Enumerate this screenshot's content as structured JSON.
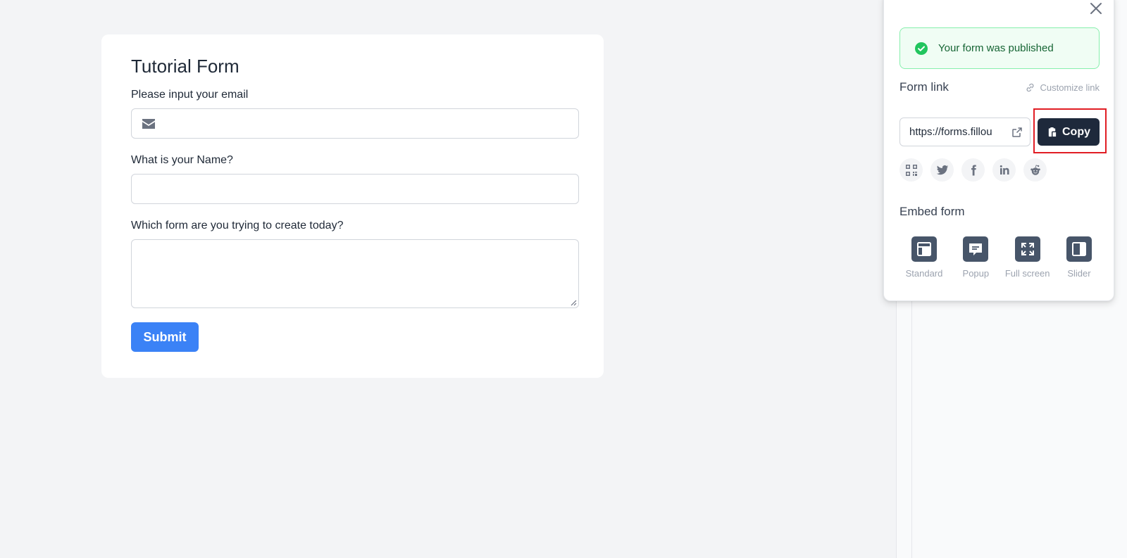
{
  "form": {
    "title": "Tutorial Form",
    "fields": [
      {
        "label": "Please input your email",
        "value": "",
        "icon": "mail-icon"
      },
      {
        "label": "What is your Name?",
        "value": ""
      },
      {
        "label": "Which form are you trying to create today?",
        "value": ""
      }
    ],
    "submit_label": "Submit"
  },
  "publish_panel": {
    "success_message": "Your form was published",
    "form_link_title": "Form link",
    "customize_link_label": "Customize link",
    "form_url": "https://forms.fillou",
    "copy_label": "Copy",
    "share_icons": [
      "qr-code-icon",
      "twitter-icon",
      "facebook-icon",
      "linkedin-icon",
      "reddit-icon"
    ],
    "embed_title": "Embed form",
    "embed_options": [
      {
        "label": "Standard",
        "icon": "standard-embed-icon"
      },
      {
        "label": "Popup",
        "icon": "popup-embed-icon"
      },
      {
        "label": "Full screen",
        "icon": "fullscreen-embed-icon"
      },
      {
        "label": "Slider",
        "icon": "slider-embed-icon"
      }
    ]
  },
  "colors": {
    "primary": "#3b82f6",
    "dark_button": "#1e293b",
    "success_bg": "#f0fdf4",
    "success_border": "#86efac",
    "success_text": "#166534",
    "success_icon": "#22c55e",
    "highlight": "#e11d24"
  }
}
